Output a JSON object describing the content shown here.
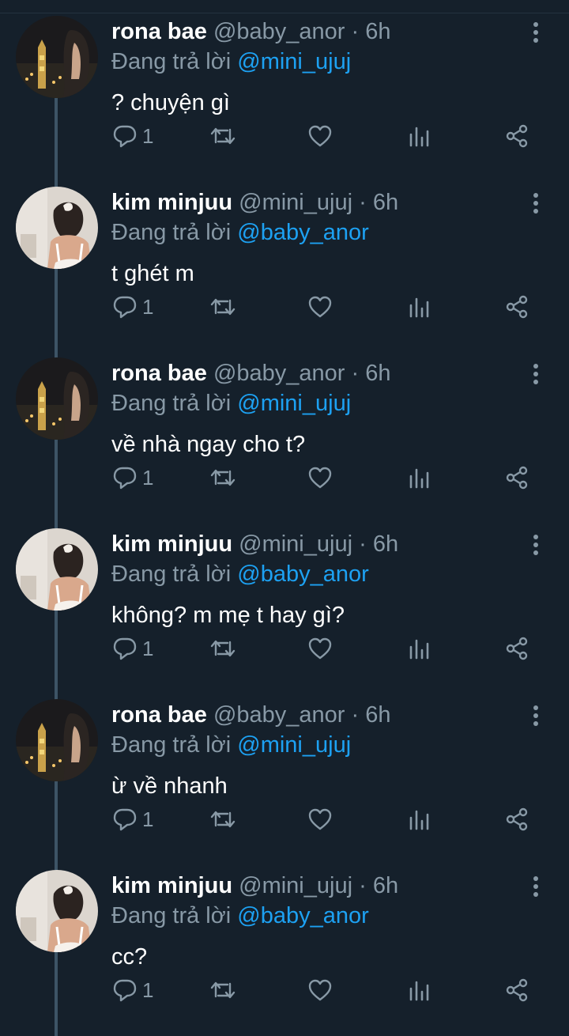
{
  "colors": {
    "background": "#15202b",
    "secondary_text": "#8899a6",
    "mention": "#1da1f2",
    "thread_line": "#3d5466"
  },
  "tweets": [
    {
      "name": "rona bae",
      "handle": "@baby_anor",
      "dot": "·",
      "time": "6h",
      "replying_prefix": "Đang trả lời",
      "reply_to": "@mini_ujuj",
      "text": "? chuyện gì",
      "reply_count": "1",
      "avatar": "city-night-avatar"
    },
    {
      "name": "kim minjuu",
      "handle": "@mini_ujuj",
      "dot": "·",
      "time": "6h",
      "replying_prefix": "Đang trả lời",
      "reply_to": "@baby_anor",
      "text": "t ghét m",
      "reply_count": "1",
      "avatar": "girl-bow-avatar"
    },
    {
      "name": "rona bae",
      "handle": "@baby_anor",
      "dot": "·",
      "time": "6h",
      "replying_prefix": "Đang trả lời",
      "reply_to": "@mini_ujuj",
      "text": "về nhà ngay cho t?",
      "reply_count": "1",
      "avatar": "city-night-avatar"
    },
    {
      "name": "kim minjuu",
      "handle": "@mini_ujuj",
      "dot": "·",
      "time": "6h",
      "replying_prefix": "Đang trả lời",
      "reply_to": "@baby_anor",
      "text": "không? m mẹ t hay gì?",
      "reply_count": "1",
      "avatar": "girl-bow-avatar"
    },
    {
      "name": "rona bae",
      "handle": "@baby_anor",
      "dot": "·",
      "time": "6h",
      "replying_prefix": "Đang trả lời",
      "reply_to": "@mini_ujuj",
      "text": "ừ về nhanh",
      "reply_count": "1",
      "avatar": "city-night-avatar"
    },
    {
      "name": "kim minjuu",
      "handle": "@mini_ujuj",
      "dot": "·",
      "time": "6h",
      "replying_prefix": "Đang trả lời",
      "reply_to": "@baby_anor",
      "text": "cc?",
      "reply_count": "1",
      "avatar": "girl-bow-avatar"
    }
  ]
}
